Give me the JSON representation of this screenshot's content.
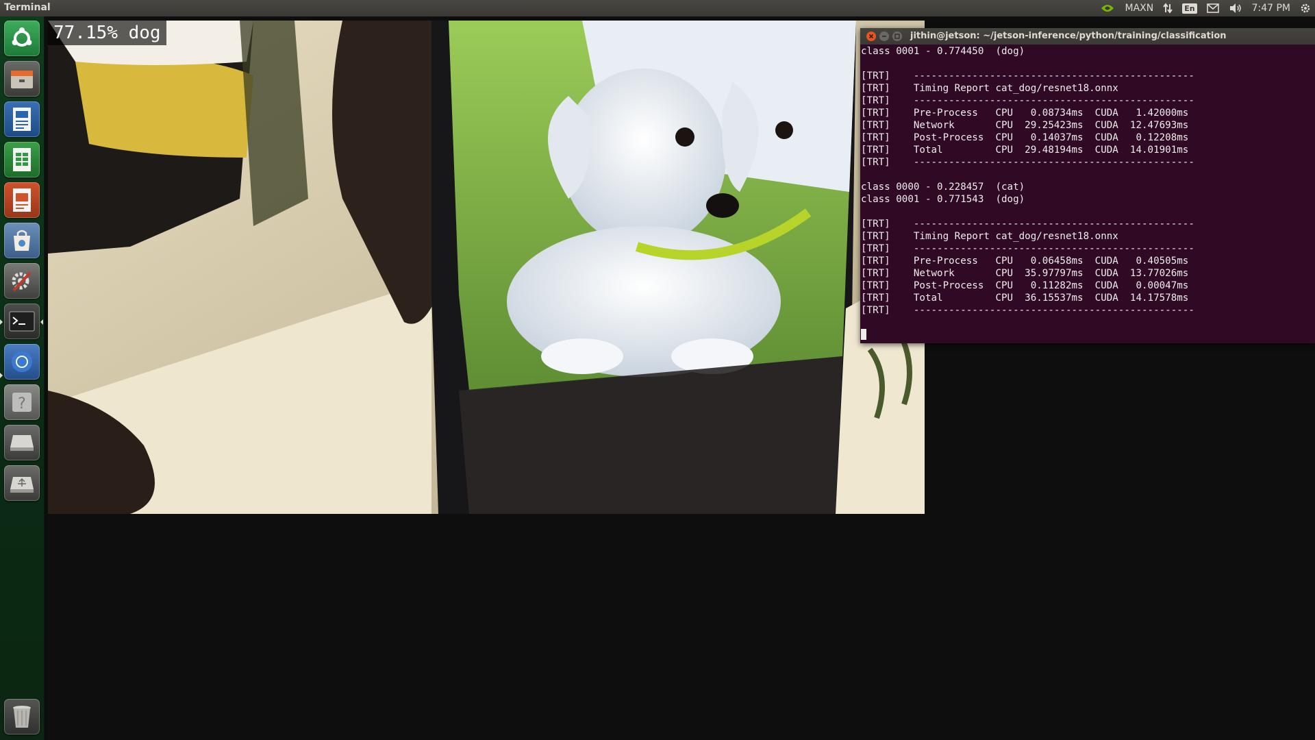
{
  "topbar": {
    "title": "Terminal",
    "indicators": {
      "nvidia_icon": "nvidia-icon",
      "power_mode": "MAXN",
      "network_icon": "network-arrows-icon",
      "language": "En",
      "mail_icon": "mail-icon",
      "volume_icon": "volume-icon",
      "time": "7:47 PM",
      "settings_icon": "gear-icon"
    }
  },
  "launcher": {
    "items": [
      {
        "name": "ubuntu-dash-icon"
      },
      {
        "name": "files-icon"
      },
      {
        "name": "libreoffice-writer-icon"
      },
      {
        "name": "libreoffice-calc-icon"
      },
      {
        "name": "libreoffice-impress-icon"
      },
      {
        "name": "software-center-icon"
      },
      {
        "name": "system-settings-icon"
      },
      {
        "name": "terminal-icon"
      },
      {
        "name": "chromium-icon"
      },
      {
        "name": "help-icon"
      },
      {
        "name": "drive-icon"
      },
      {
        "name": "usb-drive-icon"
      }
    ],
    "trash": {
      "name": "trash-icon"
    }
  },
  "camera": {
    "overlay_text": "77.15% dog"
  },
  "terminal": {
    "title": "jithin@jetson: ~/jetson-inference/python/training/classification",
    "lines": [
      "class 0001 - 0.774450  (dog)",
      "",
      "[TRT]    ------------------------------------------------",
      "[TRT]    Timing Report cat_dog/resnet18.onnx",
      "[TRT]    ------------------------------------------------",
      "[TRT]    Pre-Process   CPU   0.08734ms  CUDA   1.42000ms",
      "[TRT]    Network       CPU  29.25423ms  CUDA  12.47693ms",
      "[TRT]    Post-Process  CPU   0.14037ms  CUDA   0.12208ms",
      "[TRT]    Total         CPU  29.48194ms  CUDA  14.01901ms",
      "[TRT]    ------------------------------------------------",
      "",
      "class 0000 - 0.228457  (cat)",
      "class 0001 - 0.771543  (dog)",
      "",
      "[TRT]    ------------------------------------------------",
      "[TRT]    Timing Report cat_dog/resnet18.onnx",
      "[TRT]    ------------------------------------------------",
      "[TRT]    Pre-Process   CPU   0.06458ms  CUDA   0.40505ms",
      "[TRT]    Network       CPU  35.97797ms  CUDA  13.77026ms",
      "[TRT]    Post-Process  CPU   0.11282ms  CUDA   0.00047ms",
      "[TRT]    Total         CPU  36.15537ms  CUDA  14.17578ms",
      "[TRT]    ------------------------------------------------",
      ""
    ]
  },
  "colors": {
    "terminal_bg": "#300a24",
    "launcher_bg": "#0f3b1d",
    "close_button": "#e9541f"
  }
}
